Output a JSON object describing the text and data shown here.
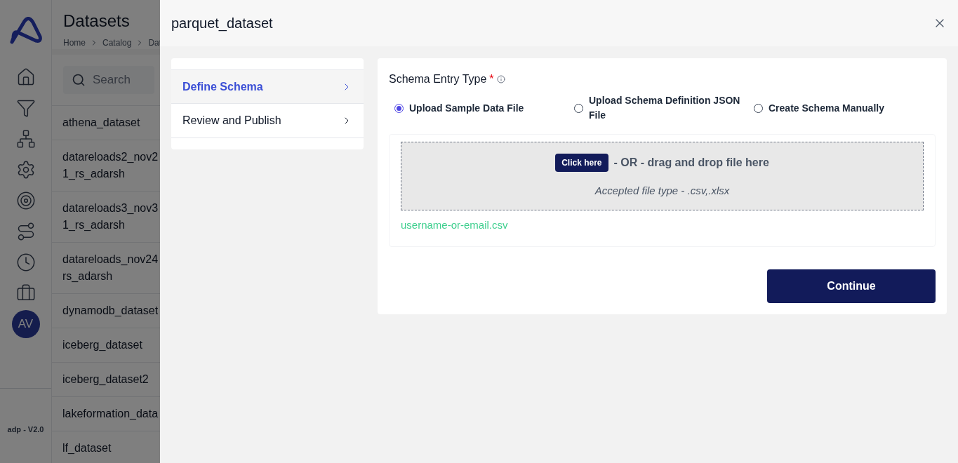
{
  "background_page": {
    "title": "Datasets",
    "breadcrumb": [
      "Home",
      "Catalog",
      "Dat"
    ],
    "search": {
      "placeholder": "Search"
    },
    "datasets": [
      [
        "athena_dataset"
      ],
      [
        "datareloads2_nov2",
        "1_rs_adarsh"
      ],
      [
        "datareloads3_nov3",
        "1_rs_adarsh"
      ],
      [
        "datareloads_nov24",
        "rs_adarsh"
      ],
      [
        "dynamodb_dataset"
      ],
      [
        "iceberg_dataset"
      ],
      [
        "iceberg_dataset2"
      ],
      [
        "lakeformation_data"
      ],
      [
        "lf_dataset"
      ]
    ],
    "avatar": "AV",
    "version": "adp - V2.0"
  },
  "drawer": {
    "title": "parquet_dataset",
    "steps": [
      {
        "label": "Define Schema",
        "selected": true
      },
      {
        "label": "Review and Publish",
        "selected": false
      }
    ],
    "schema_entry_type": {
      "label": "Schema Entry Type",
      "required_mark": "*",
      "options": [
        {
          "label": "Upload Sample Data File",
          "selected": true
        },
        {
          "label": "Upload Schema Definition JSON File",
          "selected": false
        },
        {
          "label": "Create Schema Manually",
          "selected": false
        }
      ]
    },
    "dropzone": {
      "button": "Click here",
      "text": "- OR - drag and drop file here",
      "hint": "Accepted file type - .csv,.xlsx"
    },
    "uploaded_file": "username-or-email.csv",
    "continue_button": "Continue"
  }
}
